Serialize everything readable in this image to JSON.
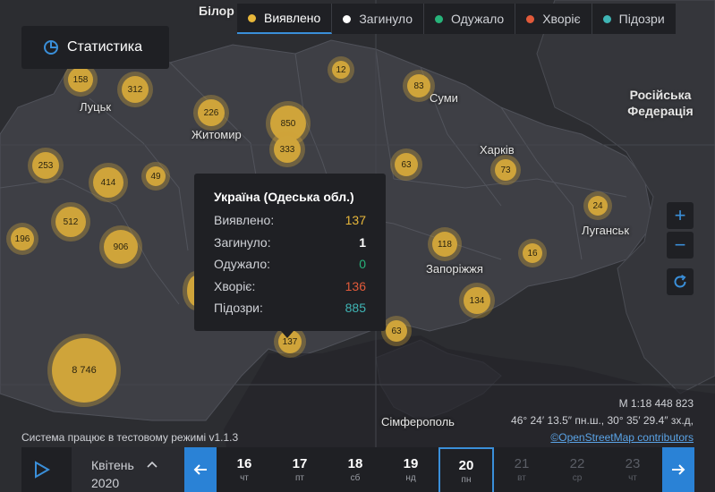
{
  "tabs": [
    {
      "label": "Виявлено",
      "color": "#e8b73a",
      "active": true
    },
    {
      "label": "Загинуло",
      "color": "#ffffff",
      "active": false
    },
    {
      "label": "Одужало",
      "color": "#27b37a",
      "active": false
    },
    {
      "label": "Хворіє",
      "color": "#e25a3a",
      "active": false
    },
    {
      "label": "Підозри",
      "color": "#3fb5b5",
      "active": false
    }
  ],
  "stats_button": "Статистика",
  "clusters": [
    "158",
    "312",
    "12",
    "83",
    "226",
    "850",
    "333",
    "253",
    "414",
    "49",
    "63",
    "73",
    "512",
    "24",
    "196",
    "906",
    "118",
    "16",
    "134",
    "63",
    "137",
    "8 746"
  ],
  "cities": [
    "Луцьк",
    "Житомир",
    "Суми",
    "Харків",
    "Луганськ",
    "Запоріжжя",
    "Сімферополь"
  ],
  "countries": {
    "belarus": "Білор",
    "russia_line1": "Російська",
    "russia_line2": "Федерація"
  },
  "tooltip": {
    "title": "Україна (Одеська обл.)",
    "rows": [
      {
        "label": "Виявлено:",
        "value": "137",
        "color": "#e8b73a"
      },
      {
        "label": "Загинуло:",
        "value": "1",
        "color": "#ffffff"
      },
      {
        "label": "Одужало:",
        "value": "0",
        "color": "#27b37a"
      },
      {
        "label": "Хворіє:",
        "value": "136",
        "color": "#e25a3a"
      },
      {
        "label": "Підозри:",
        "value": "885",
        "color": "#3fb5b5"
      }
    ]
  },
  "zoom": {
    "in": "+",
    "out": "−"
  },
  "scale": "М 1:18 448 823",
  "coords": "46° 24′ 13.5″ пн.ш., 30° 35′ 29.4″ зх.д,",
  "attribution": "©OpenStreetMap contributors",
  "test_mode": "Система працює в тестовому режимі v1.1.3",
  "month": {
    "name": "Квітень",
    "year": "2020"
  },
  "days": [
    {
      "n": "16",
      "w": "чт",
      "state": "past"
    },
    {
      "n": "17",
      "w": "пт",
      "state": "past"
    },
    {
      "n": "18",
      "w": "сб",
      "state": "past"
    },
    {
      "n": "19",
      "w": "нд",
      "state": "past"
    },
    {
      "n": "20",
      "w": "пн",
      "state": "selected"
    },
    {
      "n": "21",
      "w": "вт",
      "state": "future"
    },
    {
      "n": "22",
      "w": "ср",
      "state": "future"
    },
    {
      "n": "23",
      "w": "чт",
      "state": "future"
    }
  ]
}
